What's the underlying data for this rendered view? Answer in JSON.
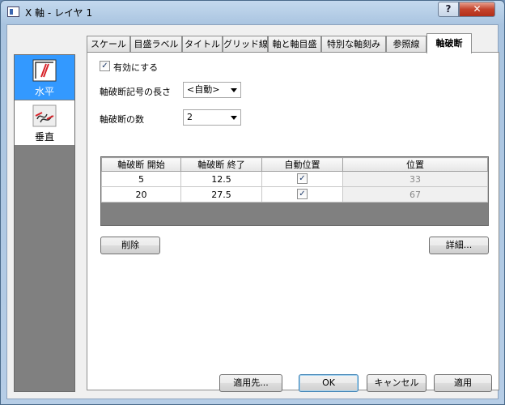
{
  "window": {
    "title": "X 軸 - レイヤ 1",
    "help_label": "?",
    "close_label": "✕"
  },
  "left_panel": {
    "items": [
      {
        "label": "水平",
        "icon": "horizontal-break-icon",
        "selected": true
      },
      {
        "label": "垂直",
        "icon": "vertical-break-icon",
        "selected": false
      }
    ]
  },
  "tabs": [
    {
      "label": "スケール"
    },
    {
      "label": "目盛ラベル"
    },
    {
      "label": "タイトル"
    },
    {
      "label": "グリッド線"
    },
    {
      "label": "軸と軸目盛"
    },
    {
      "label": "特別な軸刻み"
    },
    {
      "label": "参照線"
    },
    {
      "label": "軸破断",
      "active": true
    }
  ],
  "panel": {
    "enable_label": "有効にする",
    "enable_checked": true,
    "symbol_length_label": "軸破断記号の長さ",
    "symbol_length_value": "<自動>",
    "count_label": "軸破断の数",
    "count_value": "2"
  },
  "table": {
    "headers": [
      "軸破断 開始",
      "軸破断 終了",
      "自動位置",
      "位置"
    ],
    "rows": [
      {
        "start": "5",
        "end": "12.5",
        "auto": true,
        "position": "33"
      },
      {
        "start": "20",
        "end": "27.5",
        "auto": true,
        "position": "67"
      }
    ]
  },
  "buttons": {
    "delete": "削除",
    "details": "詳細...",
    "apply_to": "適用先...",
    "ok": "OK",
    "cancel": "キャンセル",
    "apply": "適用"
  },
  "colors": {
    "selection": "#3399ff",
    "break_mark": "#d8232a"
  }
}
